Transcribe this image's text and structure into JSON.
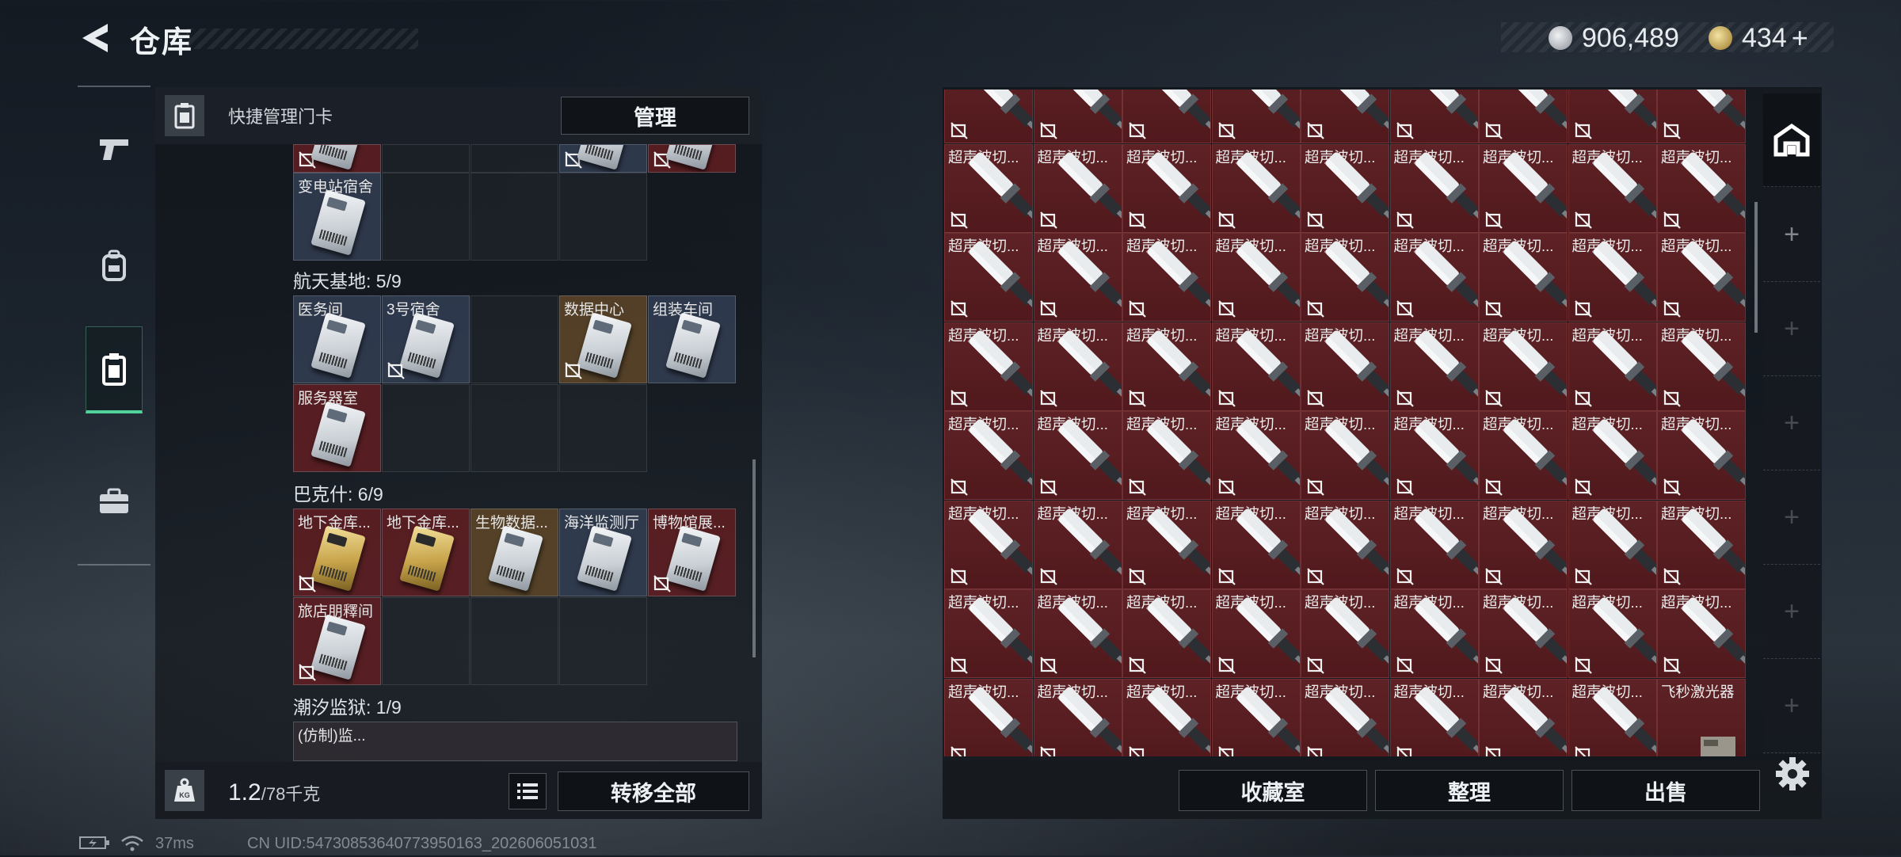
{
  "header": {
    "title": "仓库"
  },
  "currency": [
    {
      "icon": "silver-coin-icon",
      "value": "906,489",
      "color": "#b8bec6"
    },
    {
      "icon": "gold-token-icon",
      "value": "434",
      "add_label": "+",
      "color": "#c8a448"
    }
  ],
  "rail": [
    {
      "icon": "pistol-icon",
      "active": false
    },
    {
      "icon": "backpack-icon",
      "active": false
    },
    {
      "icon": "keycard-case-icon",
      "active": true
    },
    {
      "icon": "briefcase-icon",
      "active": false
    }
  ],
  "left_panel": {
    "header_label": "快捷管理门卡",
    "manage_label": "管理",
    "sections": [
      {
        "label": "",
        "rows": 1.33,
        "top": 0
      },
      {
        "label": "航天基地: 5/9"
      },
      {
        "label": "巴克什: 6/9"
      },
      {
        "label": "潮汐监狱: 1/9"
      }
    ],
    "partial_top": [
      {
        "name": "",
        "bg": "red",
        "card": true,
        "nosell": true
      },
      {
        "name": "",
        "bg": "",
        "card": false,
        "nosell": false
      },
      {
        "name": "",
        "bg": "",
        "card": false,
        "nosell": false
      },
      {
        "name": "",
        "bg": "blue",
        "card": true,
        "nosell": true
      },
      {
        "name": "",
        "bg": "red",
        "card": true,
        "nosell": true
      }
    ],
    "station_cards": [
      {
        "name": "变电站宿舍",
        "bg": "blue",
        "card": "silver",
        "nosell": false
      }
    ],
    "space_base_cards": [
      {
        "name": "医务间",
        "bg": "blue",
        "card": "silver",
        "nosell": false
      },
      {
        "name": "3号宿舍",
        "bg": "blue",
        "card": "silver",
        "nosell": true
      },
      {
        "name": "",
        "bg": "",
        "card": "",
        "nosell": false
      },
      {
        "name": "数据中心",
        "bg": "gold",
        "card": "silver",
        "nosell": true
      },
      {
        "name": "组装车间",
        "bg": "blue",
        "card": "silver",
        "nosell": false
      },
      {
        "name": "服务器室",
        "bg": "red",
        "card": "silver",
        "nosell": false
      }
    ],
    "bakshi_cards": [
      {
        "name": "地下金库...",
        "bg": "red",
        "card": "gold",
        "nosell": true
      },
      {
        "name": "地下金库...",
        "bg": "red",
        "card": "gold",
        "nosell": false
      },
      {
        "name": "生物数据...",
        "bg": "gold",
        "card": "silver",
        "nosell": false
      },
      {
        "name": "海洋监测厅",
        "bg": "blue",
        "card": "silver",
        "nosell": false
      },
      {
        "name": "博物馆展...",
        "bg": "red",
        "card": "silver",
        "nosell": true
      },
      {
        "name": "旅店朋釋间",
        "bg": "red",
        "card": "silver",
        "nosell": true
      }
    ],
    "tidal_cards": [
      {
        "name": "(仿制)监...",
        "bg": "dark",
        "card": "silver",
        "nosell": false
      }
    ],
    "weight_current": "1.2",
    "weight_max": "/78千克",
    "transfer_label": "转移全部"
  },
  "right_panel": {
    "item_name": "超声波切...",
    "last_item_name": "飞秒激光器",
    "columns": 9,
    "rows": 8,
    "collect_label": "收藏室",
    "sort_label": "整理",
    "sell_label": "出售",
    "side_tabs": [
      "home-vault-icon",
      "+",
      "+",
      "+",
      "+",
      "+",
      "+"
    ]
  },
  "status": {
    "ping": "37ms",
    "uid": "CN UID:54730853640773950163_202606051031"
  }
}
